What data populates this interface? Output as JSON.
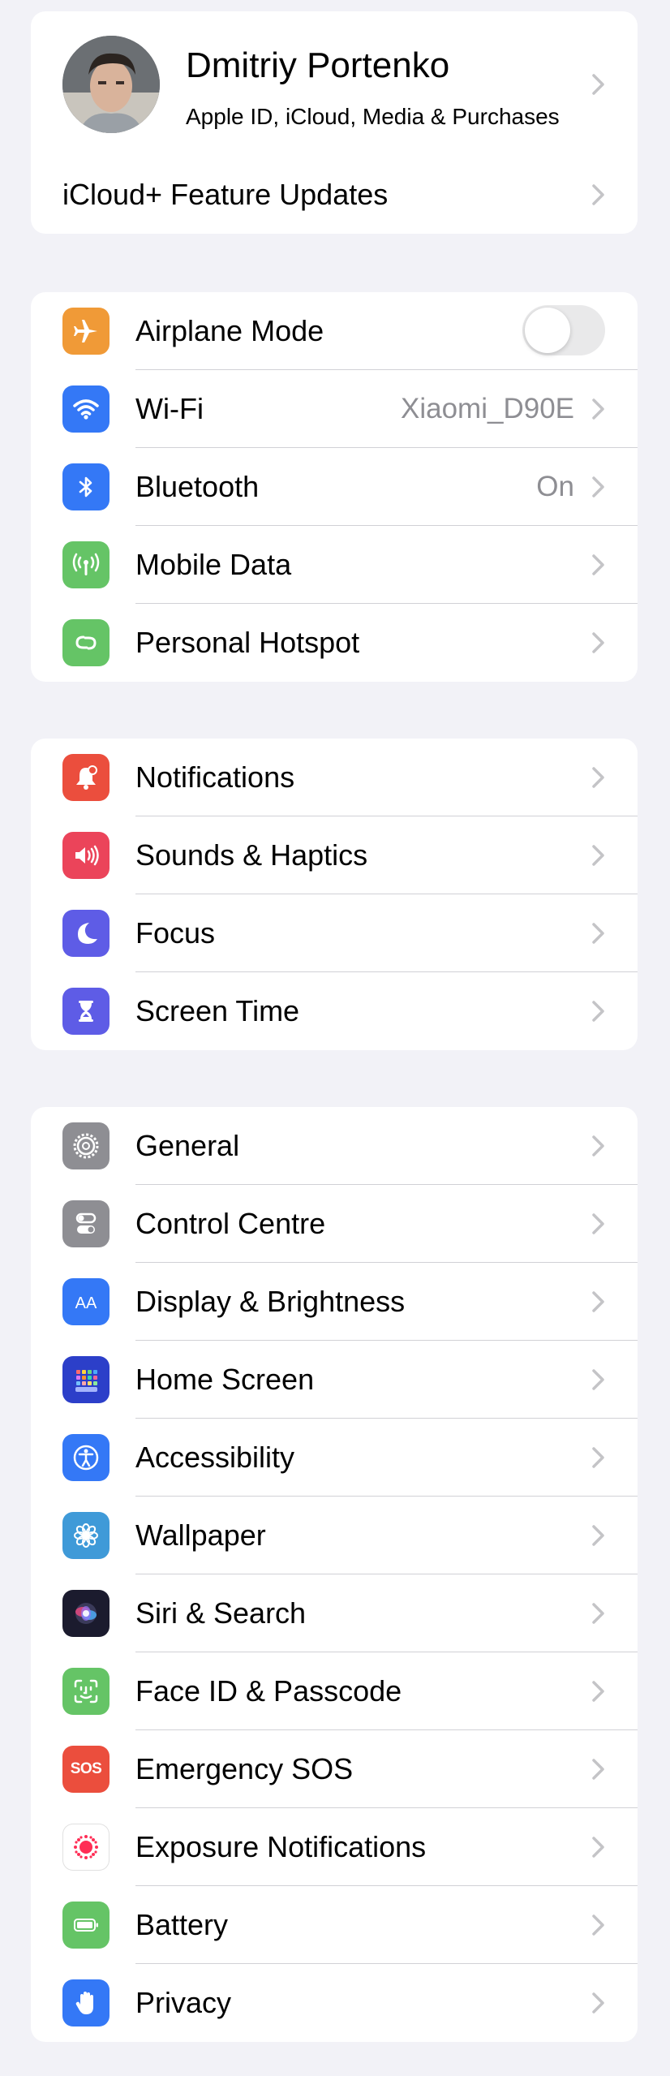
{
  "profile": {
    "name": "Dmitriy Portenko",
    "subtitle": "Apple ID, iCloud, Media & Purchases"
  },
  "icloud_updates": {
    "label": "iCloud+ Feature Updates"
  },
  "connectivity": [
    {
      "label": "Airplane Mode",
      "icon": "airplane-icon",
      "color": "#f09a37",
      "toggle": false
    },
    {
      "label": "Wi-Fi",
      "icon": "wifi-icon",
      "color": "#3478f6",
      "value": "Xiaomi_D90E"
    },
    {
      "label": "Bluetooth",
      "icon": "bluetooth-icon",
      "color": "#3478f6",
      "value": "On"
    },
    {
      "label": "Mobile Data",
      "icon": "antenna-icon",
      "color": "#65c466"
    },
    {
      "label": "Personal Hotspot",
      "icon": "hotspot-icon",
      "color": "#65c466"
    }
  ],
  "alerts": [
    {
      "label": "Notifications",
      "icon": "bell-icon",
      "color": "#eb4e3d"
    },
    {
      "label": "Sounds & Haptics",
      "icon": "speaker-icon",
      "color": "#eb445a"
    },
    {
      "label": "Focus",
      "icon": "moon-icon",
      "color": "#5e5ce6"
    },
    {
      "label": "Screen Time",
      "icon": "hourglass-icon",
      "color": "#5e5ce6"
    }
  ],
  "system": [
    {
      "label": "General",
      "icon": "gear-icon",
      "color": "#8e8e93"
    },
    {
      "label": "Control Centre",
      "icon": "switches-icon",
      "color": "#8e8e93"
    },
    {
      "label": "Display & Brightness",
      "icon": "text-size-icon",
      "color": "#3478f6"
    },
    {
      "label": "Home Screen",
      "icon": "app-grid-icon",
      "color": "#2c3fc9"
    },
    {
      "label": "Accessibility",
      "icon": "accessibility-icon",
      "color": "#3478f6"
    },
    {
      "label": "Wallpaper",
      "icon": "flower-icon",
      "color": "#3f9ad8"
    },
    {
      "label": "Siri & Search",
      "icon": "siri-icon",
      "color": "#1b1b2e"
    },
    {
      "label": "Face ID & Passcode",
      "icon": "face-id-icon",
      "color": "#65c466"
    },
    {
      "label": "Emergency SOS",
      "icon": "sos-icon",
      "color": "#eb4e3d",
      "icon_text": "SOS"
    },
    {
      "label": "Exposure Notifications",
      "icon": "exposure-icon",
      "color": "#ffffff"
    },
    {
      "label": "Battery",
      "icon": "battery-icon",
      "color": "#65c466"
    },
    {
      "label": "Privacy",
      "icon": "hand-icon",
      "color": "#3478f6"
    }
  ]
}
